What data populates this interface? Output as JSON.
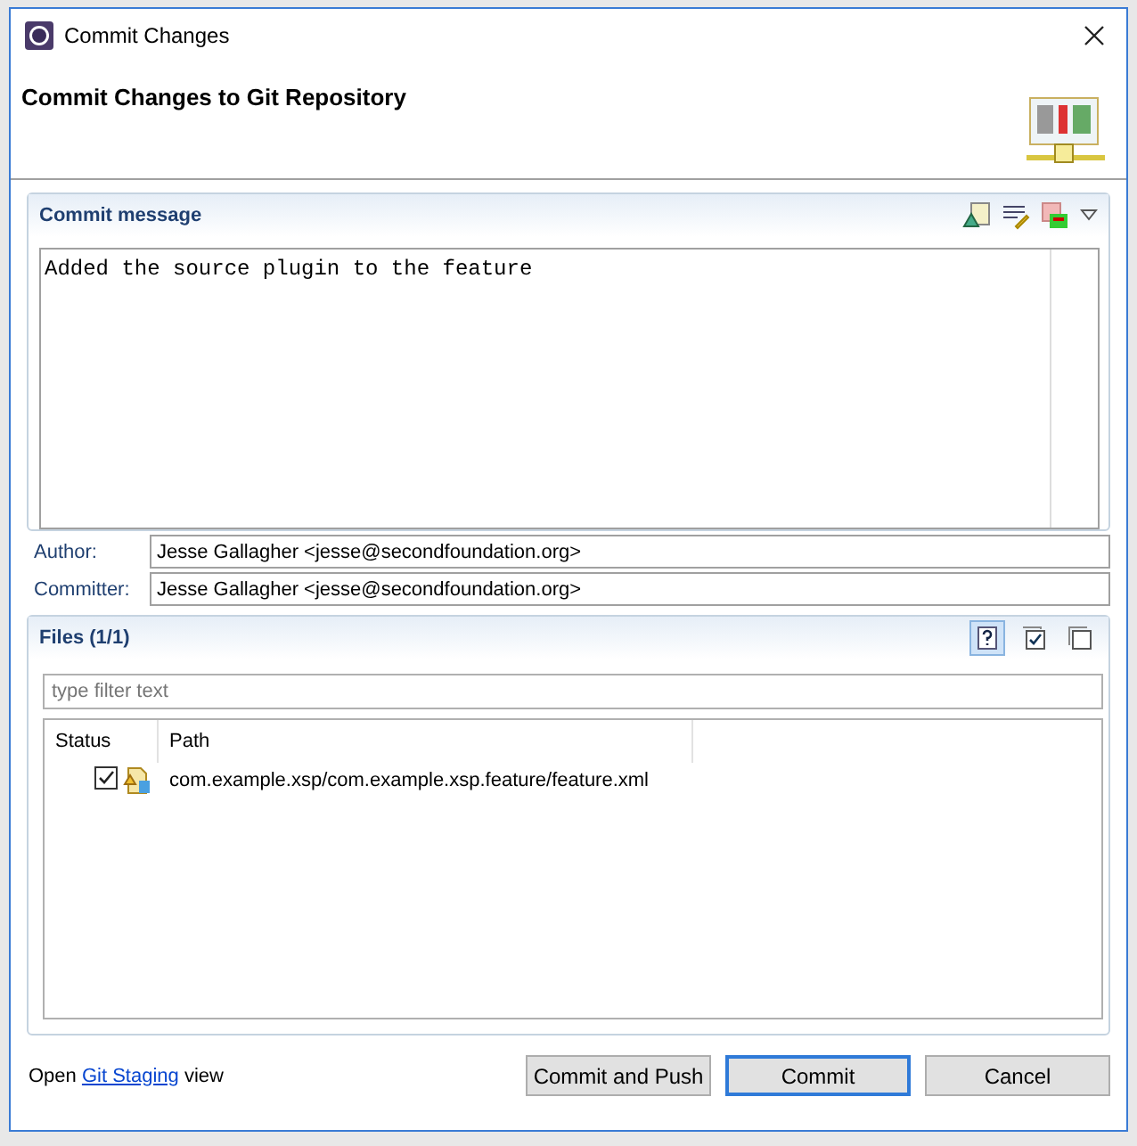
{
  "window": {
    "title": "Commit Changes"
  },
  "header": {
    "title": "Commit Changes to Git Repository"
  },
  "commit_section": {
    "title": "Commit message",
    "message": "Added the source plugin to the feature"
  },
  "author": {
    "label": "Author:",
    "value": "Jesse Gallagher <jesse@secondfoundation.org>"
  },
  "committer": {
    "label": "Committer:",
    "value": "Jesse Gallagher <jesse@secondfoundation.org>"
  },
  "files_section": {
    "title": "Files (1/1)",
    "toolbar": [
      {
        "kind": "untracked",
        "selected": true
      },
      {
        "kind": "check-all",
        "selected": false
      },
      {
        "kind": "uncheck-all",
        "selected": false
      }
    ],
    "filter": {
      "placeholder": "type filter text"
    },
    "columns": [
      "Status",
      "Path"
    ],
    "rows": [
      {
        "checked": true,
        "path": "com.example.xsp/com.example.xsp.feature/feature.xml"
      }
    ]
  },
  "footer": {
    "before": "Open",
    "link": "Git Staging",
    "after": "view"
  },
  "buttons": [
    {
      "label": "Commit and Push",
      "default": false
    },
    {
      "label": "Commit",
      "default": true
    },
    {
      "label": "Cancel",
      "default": false
    }
  ]
}
